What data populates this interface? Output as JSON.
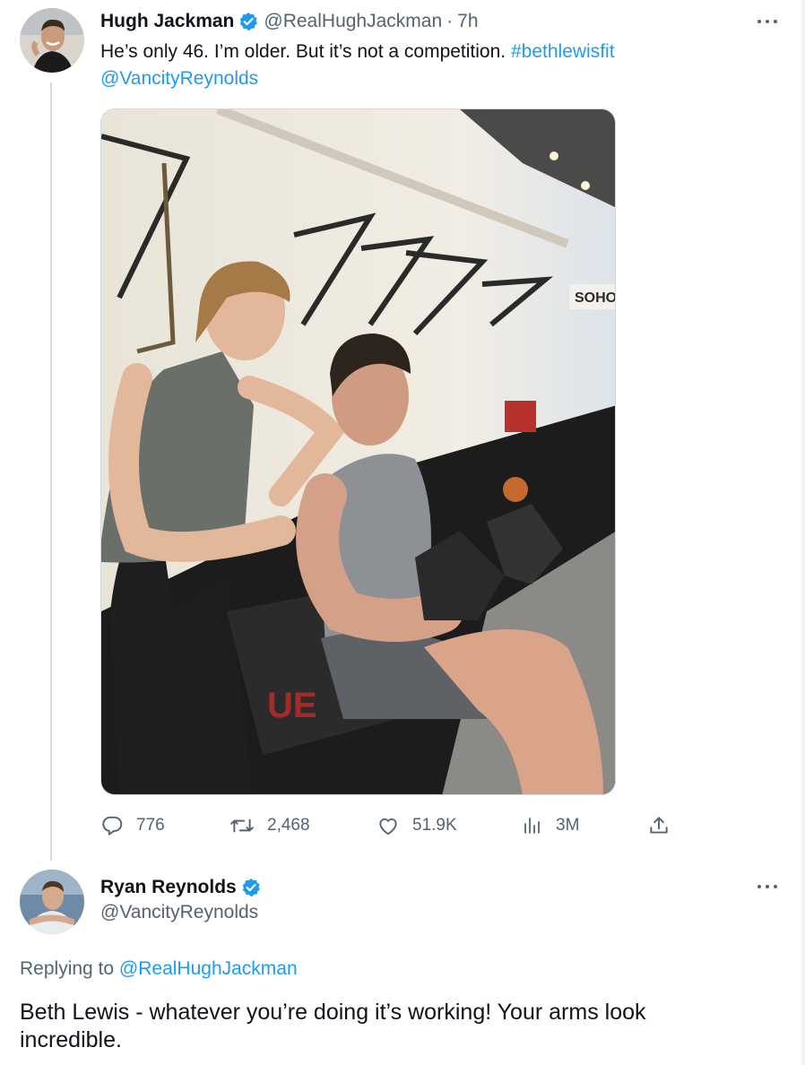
{
  "tweet": {
    "author_name": "Hugh Jackman",
    "handle": "@RealHughJackman",
    "separator": "·",
    "time": "7h",
    "text_line1": "He’s only 46. I’m older. But it’s not a competition.",
    "hashtag": "#bethlewisfit",
    "mention": "@VancityReynolds",
    "media_sign_text": "SOHO",
    "media_bench_text": "UE",
    "stats": {
      "replies": "776",
      "retweets": "2,468",
      "likes": "51.9K",
      "views": "3M"
    },
    "icons": {
      "avatar": "hugh-jackman-avatar",
      "verified": "verified-badge-icon",
      "more": "more-options-icon",
      "reply": "reply-icon",
      "retweet": "retweet-icon",
      "like": "heart-icon",
      "views": "views-icon",
      "share": "share-icon"
    }
  },
  "reply": {
    "author_name": "Ryan Reynolds",
    "handle": "@VancityReynolds",
    "replying_to_label": "Replying to",
    "replying_to_handle": "@RealHughJackman",
    "text": "Beth Lewis - whatever you’re doing it’s working! Your arms look incredible."
  },
  "colors": {
    "text": "#0f1419",
    "secondary": "#536471",
    "link": "#1d9bf0",
    "verified": "#1d9bf0",
    "border": "#cfd9de"
  }
}
